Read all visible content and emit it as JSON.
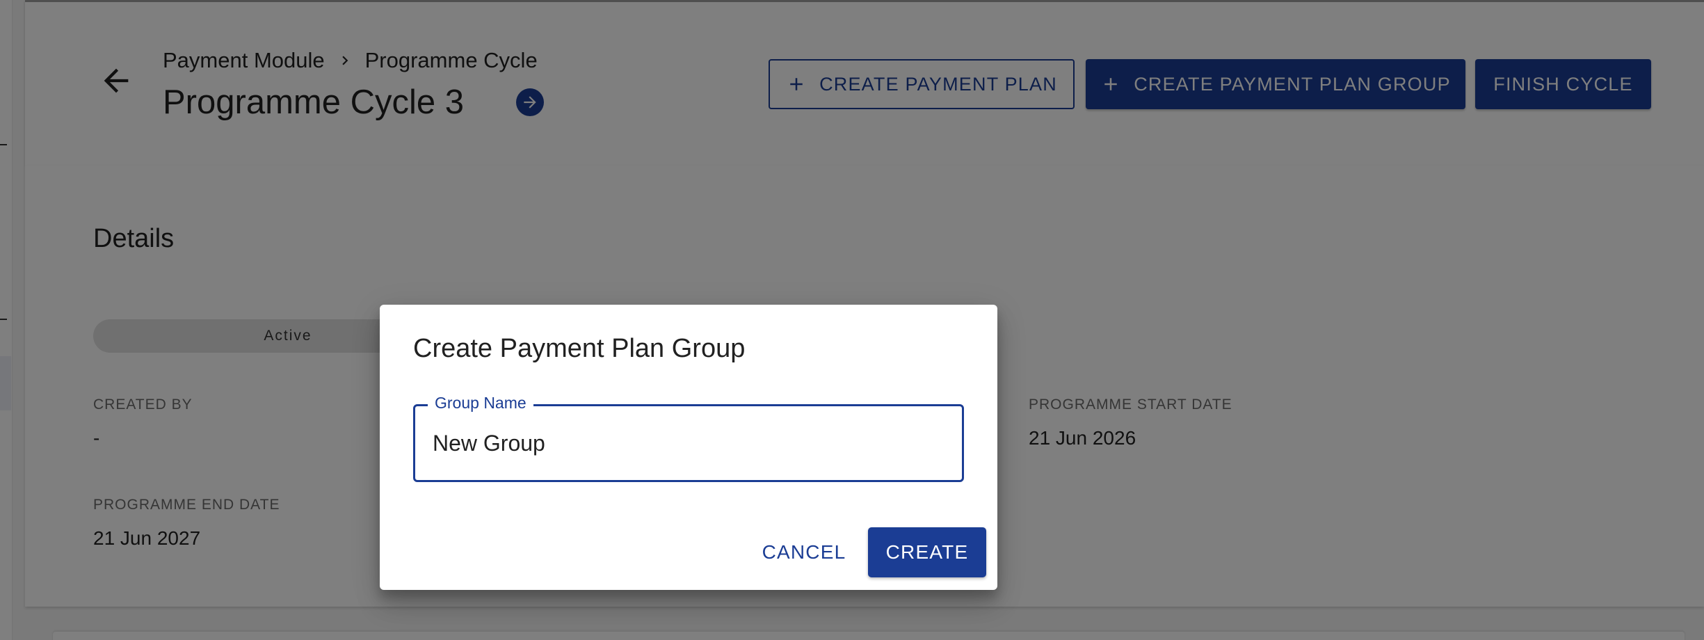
{
  "header": {
    "breadcrumb": [
      "Payment Module",
      "Programme Cycle"
    ],
    "title": "Programme Cycle 3",
    "buttons": {
      "create_payment_plan": "CREATE PAYMENT PLAN",
      "create_payment_plan_group": "CREATE PAYMENT PLAN GROUP",
      "finish_cycle": "FINISH CYCLE"
    }
  },
  "details": {
    "title": "Details",
    "status": "Active",
    "fields": {
      "created_by": {
        "label": "CREATED BY",
        "value": "-"
      },
      "programme_start_date": {
        "label": "PROGRAMME START DATE",
        "value": "21 Jun 2026"
      },
      "programme_end_date": {
        "label": "PROGRAMME END DATE",
        "value": "21 Jun 2027"
      }
    }
  },
  "dialog": {
    "title": "Create Payment Plan Group",
    "group_name_label": "Group Name",
    "group_name_value": "New Group",
    "cancel_label": "CANCEL",
    "create_label": "CREATE"
  },
  "icons": {
    "back": "arrow-left-icon",
    "breadcrumb_separator": "chevron-right-icon",
    "title_link": "arrow-circle-right-icon",
    "add": "plus-icon"
  },
  "colors": {
    "primary": "#1b3d94",
    "backdrop": "rgba(0,0,0,0.5)",
    "chip": "#e0e0e0"
  }
}
